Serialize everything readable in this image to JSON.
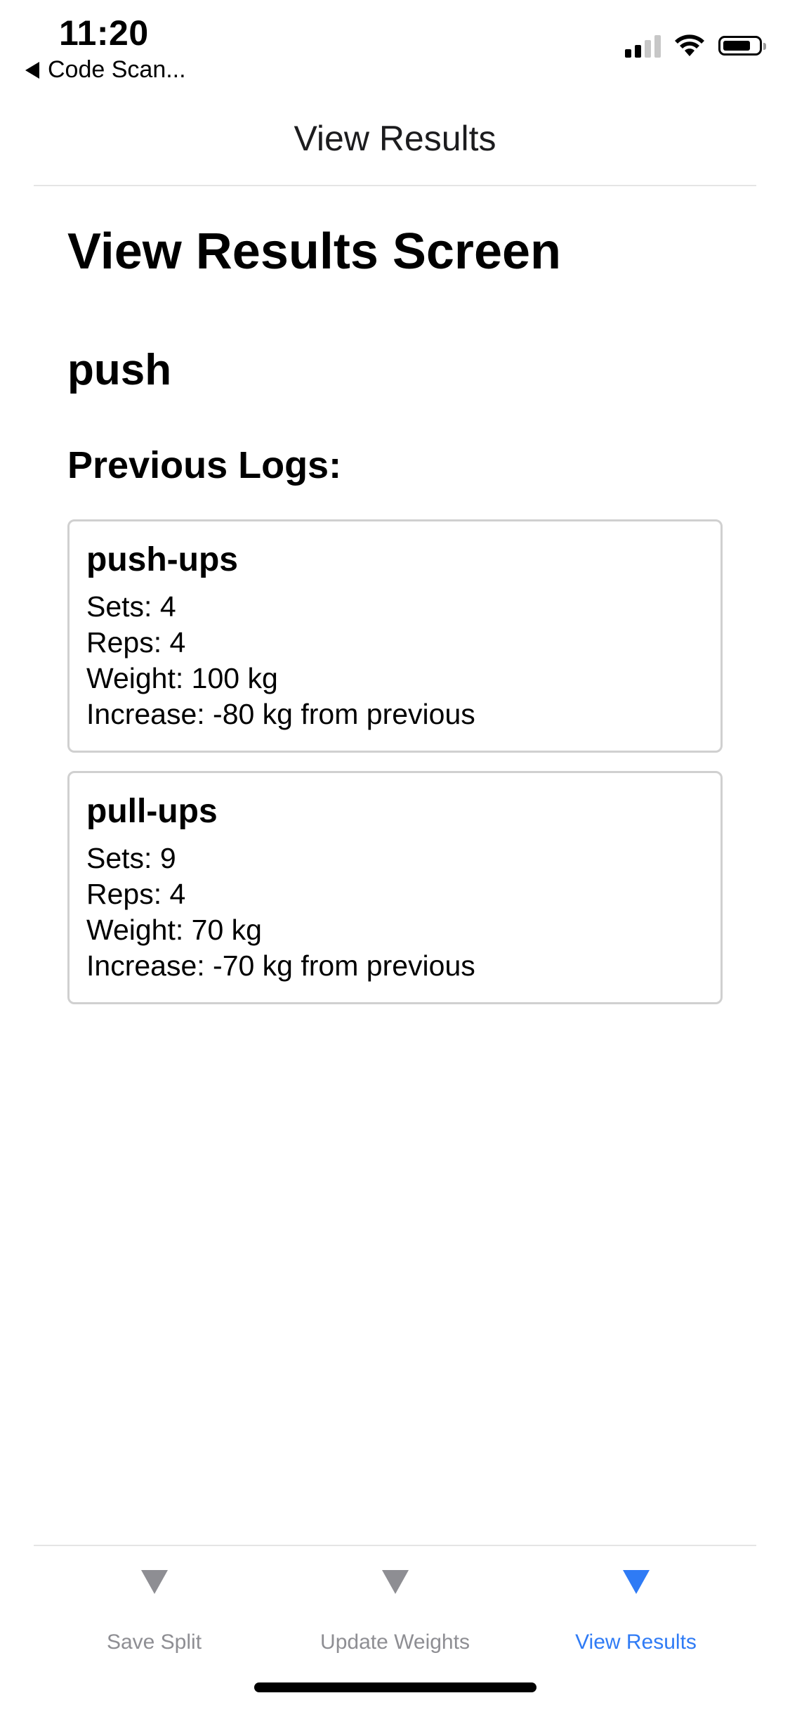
{
  "status_bar": {
    "time": "11:20",
    "back_app": "Code Scan...",
    "icons": [
      "signal-icon",
      "wifi-icon",
      "battery-icon"
    ]
  },
  "header": {
    "title": "View Results"
  },
  "main": {
    "screen_title": "View Results Screen",
    "split_name": "push",
    "logs_heading": "Previous Logs:",
    "logs": [
      {
        "exercise": "push-ups",
        "sets": "Sets: 4",
        "reps": "Reps: 4",
        "weight": "Weight: 100 kg",
        "increase": "Increase: -80 kg from previous"
      },
      {
        "exercise": "pull-ups",
        "sets": "Sets: 9",
        "reps": "Reps: 4",
        "weight": "Weight: 70 kg",
        "increase": "Increase: -70 kg from previous"
      }
    ]
  },
  "tab_bar": {
    "tabs": [
      {
        "label": "Save Split",
        "icon": "triangle-down-icon",
        "active": false
      },
      {
        "label": "Update Weights",
        "icon": "triangle-down-icon",
        "active": false
      },
      {
        "label": "View Results",
        "icon": "triangle-down-icon",
        "active": true
      }
    ]
  },
  "colors": {
    "accent": "#2f7bf5",
    "inactive": "#8e8e93",
    "card_border": "#d0d0d0",
    "divider": "#e5e5e5"
  }
}
